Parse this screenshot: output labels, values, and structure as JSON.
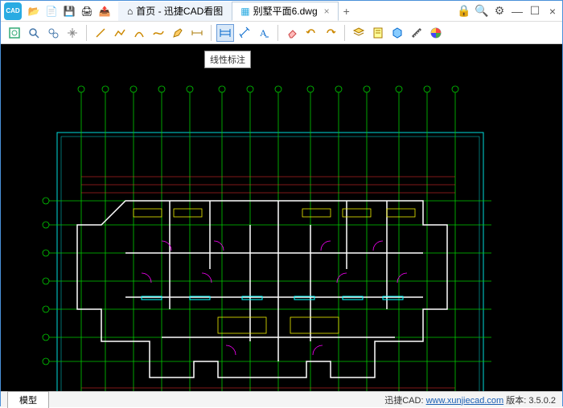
{
  "app": {
    "name": "迅捷CAD",
    "logo_text": "CAD"
  },
  "titlebar": {
    "tabs": [
      {
        "label": "首页 - 迅捷CAD看图",
        "icon": "home"
      },
      {
        "label": "别墅平面6.dwg",
        "icon": "doc"
      }
    ],
    "add": "+",
    "close": "×"
  },
  "winctrl": {
    "lock": "🔒",
    "search": "🔍",
    "gear": "⚙",
    "min": "—",
    "max": "☐",
    "close": "×"
  },
  "toolbar_groups": [
    [
      "zoom-extents",
      "zoom-window",
      "zoom-realtime",
      "pan"
    ],
    [
      "line",
      "polyline",
      "arc",
      "spline",
      "edit",
      "dimension-tool"
    ],
    [
      "linear-dim",
      "aligned-dim",
      "text"
    ],
    [
      "erase",
      "undo",
      "redo"
    ],
    [
      "layer",
      "properties",
      "block",
      "measure",
      "color"
    ]
  ],
  "tooltip": "线性标注",
  "bottom": {
    "tab": "模型",
    "brand": "迅捷CAD:",
    "url_text": "www.xunjiecad.com",
    "version_label": "版本:",
    "version": "3.5.0.2"
  },
  "file_icons": {
    "open": "📂",
    "new": "📄",
    "save": "💾",
    "print": "🖨",
    "export": "📤"
  }
}
